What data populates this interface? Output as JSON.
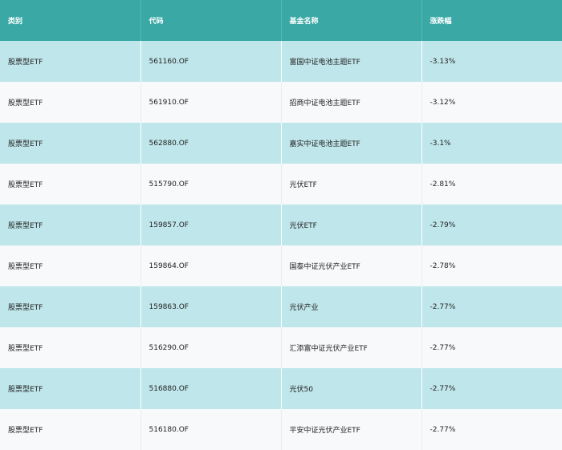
{
  "table": {
    "headers": [
      "类别",
      "代码",
      "基金名称",
      "涨跌幅"
    ],
    "rows": [
      [
        "股票型ETF",
        "561160.OF",
        "富国中证电池主题ETF",
        "-3.13%"
      ],
      [
        "股票型ETF",
        "561910.OF",
        "招商中证电池主题ETF",
        "-3.12%"
      ],
      [
        "股票型ETF",
        "562880.OF",
        "嘉实中证电池主题ETF",
        "-3.1%"
      ],
      [
        "股票型ETF",
        "515790.OF",
        "光伏ETF",
        "-2.81%"
      ],
      [
        "股票型ETF",
        "159857.OF",
        "光伏ETF",
        "-2.79%"
      ],
      [
        "股票型ETF",
        "159864.OF",
        "国泰中证光伏产业ETF",
        "-2.78%"
      ],
      [
        "股票型ETF",
        "159863.OF",
        "光伏产业",
        "-2.77%"
      ],
      [
        "股票型ETF",
        "516290.OF",
        "汇添富中证光伏产业ETF",
        "-2.77%"
      ],
      [
        "股票型ETF",
        "516880.OF",
        "光伏50",
        "-2.77%"
      ],
      [
        "股票型ETF",
        "516180.OF",
        "平安中证光伏产业ETF",
        "-2.77%"
      ]
    ]
  },
  "colors": {
    "header_bg": "#3aa9a6",
    "row_odd_bg": "#bfe6ea",
    "row_even_bg": "#f7f9fb"
  }
}
